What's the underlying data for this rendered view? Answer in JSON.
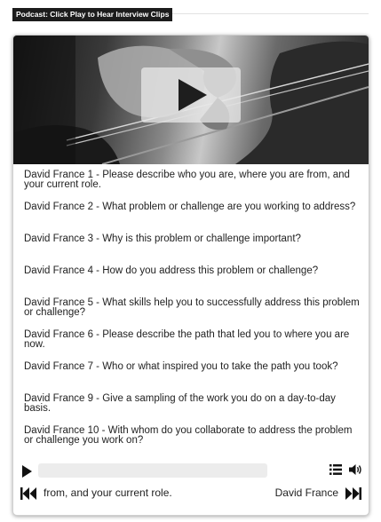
{
  "header": {
    "label": "Podcast: Click Play to Hear Interview Clips"
  },
  "playlist": {
    "items": [
      {
        "label": "David France 1 - Please describe who you are, where you are from, and your current role."
      },
      {
        "label": "David France 2 - What problem or challenge are you working to address?"
      },
      {
        "label": "David France 3 - Why is this problem or challenge important?"
      },
      {
        "label": "David France 4 - How do you address this problem or challenge?"
      },
      {
        "label": "David France 5 - What skills help you to successfully address this problem or challenge?"
      },
      {
        "label": "David France 6 - Please describe the path that led you to where you are now."
      },
      {
        "label": "David France 7 - Who or what inspired you to take the path you took?"
      },
      {
        "label": "David France 9 - Give a sampling of the work you do on a day-to-day basis."
      },
      {
        "label": "David France 10 - With whom do you collaborate to address the problem or challenge you work on?"
      }
    ]
  },
  "controls": {
    "play_icon": "play-icon",
    "playlist_icon": "list-icon",
    "volume_icon": "volume-icon",
    "prev_icon": "skip-back-icon",
    "next_icon": "skip-forward-icon",
    "progress": 0
  },
  "now_playing": {
    "scroll_text": "from, and your current role.",
    "title": "David France"
  }
}
